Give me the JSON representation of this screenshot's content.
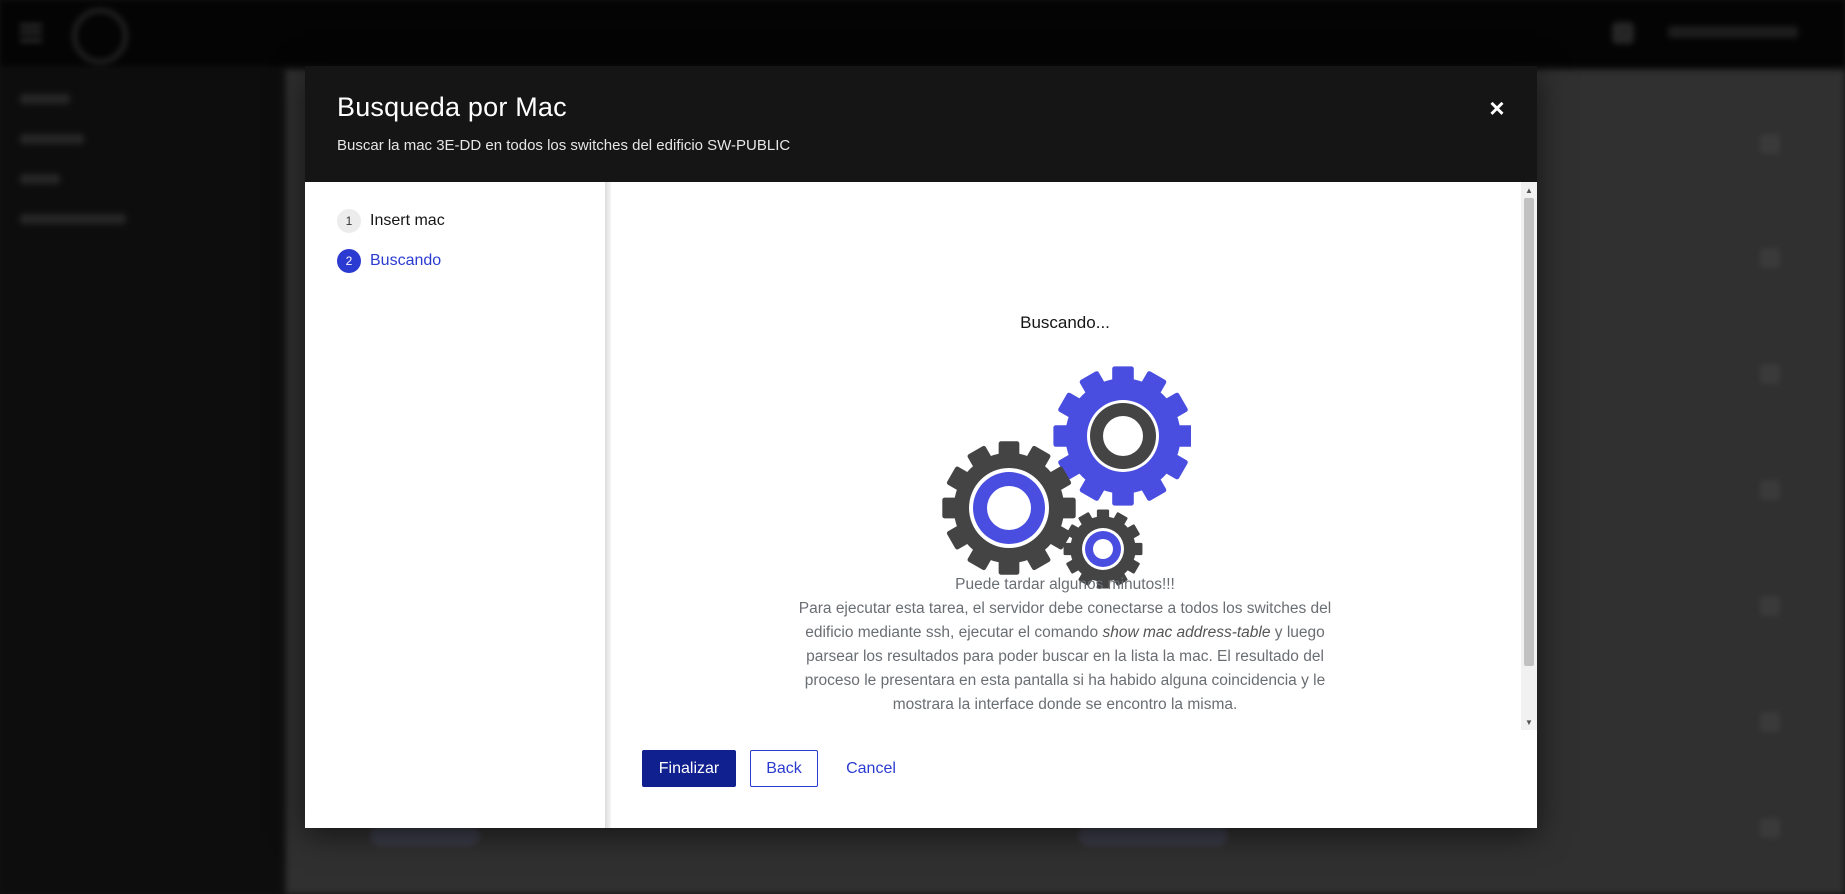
{
  "modal": {
    "title": "Busqueda por Mac",
    "description": "Buscar la mac 3E-DD en todos los switches del edificio SW-PUBLIC",
    "close_icon": "×"
  },
  "wizard": {
    "steps": [
      {
        "number": "1",
        "label": "Insert mac",
        "state": "done"
      },
      {
        "number": "2",
        "label": "Buscando",
        "state": "current"
      }
    ],
    "body": {
      "title": "Buscando...",
      "illustration_icon": "gears-icon",
      "line1": "Puede tardar algunos minutos!!!",
      "para_before_cmd": "Para ejecutar esta tarea, el servidor debe conectarse a todos los switches del edificio mediante ssh, ejecutar el comando ",
      "command": "show mac address-table",
      "para_after_cmd": " y luego parsear los resultados para poder buscar en la lista la mac. El resultado del proceso le presentara en esta pantalla si ha habido alguna coincidencia y le mostrara la interface donde se encontro la misma."
    },
    "footer": {
      "finish_label": "Finalizar",
      "back_label": "Back",
      "cancel_label": "Cancel"
    }
  },
  "colors": {
    "accent_blue": "#2b3bd1",
    "primary_button": "#10208f",
    "gear_blue": "#4a4ee0",
    "gear_dark": "#444444",
    "header_bg": "#151515"
  }
}
